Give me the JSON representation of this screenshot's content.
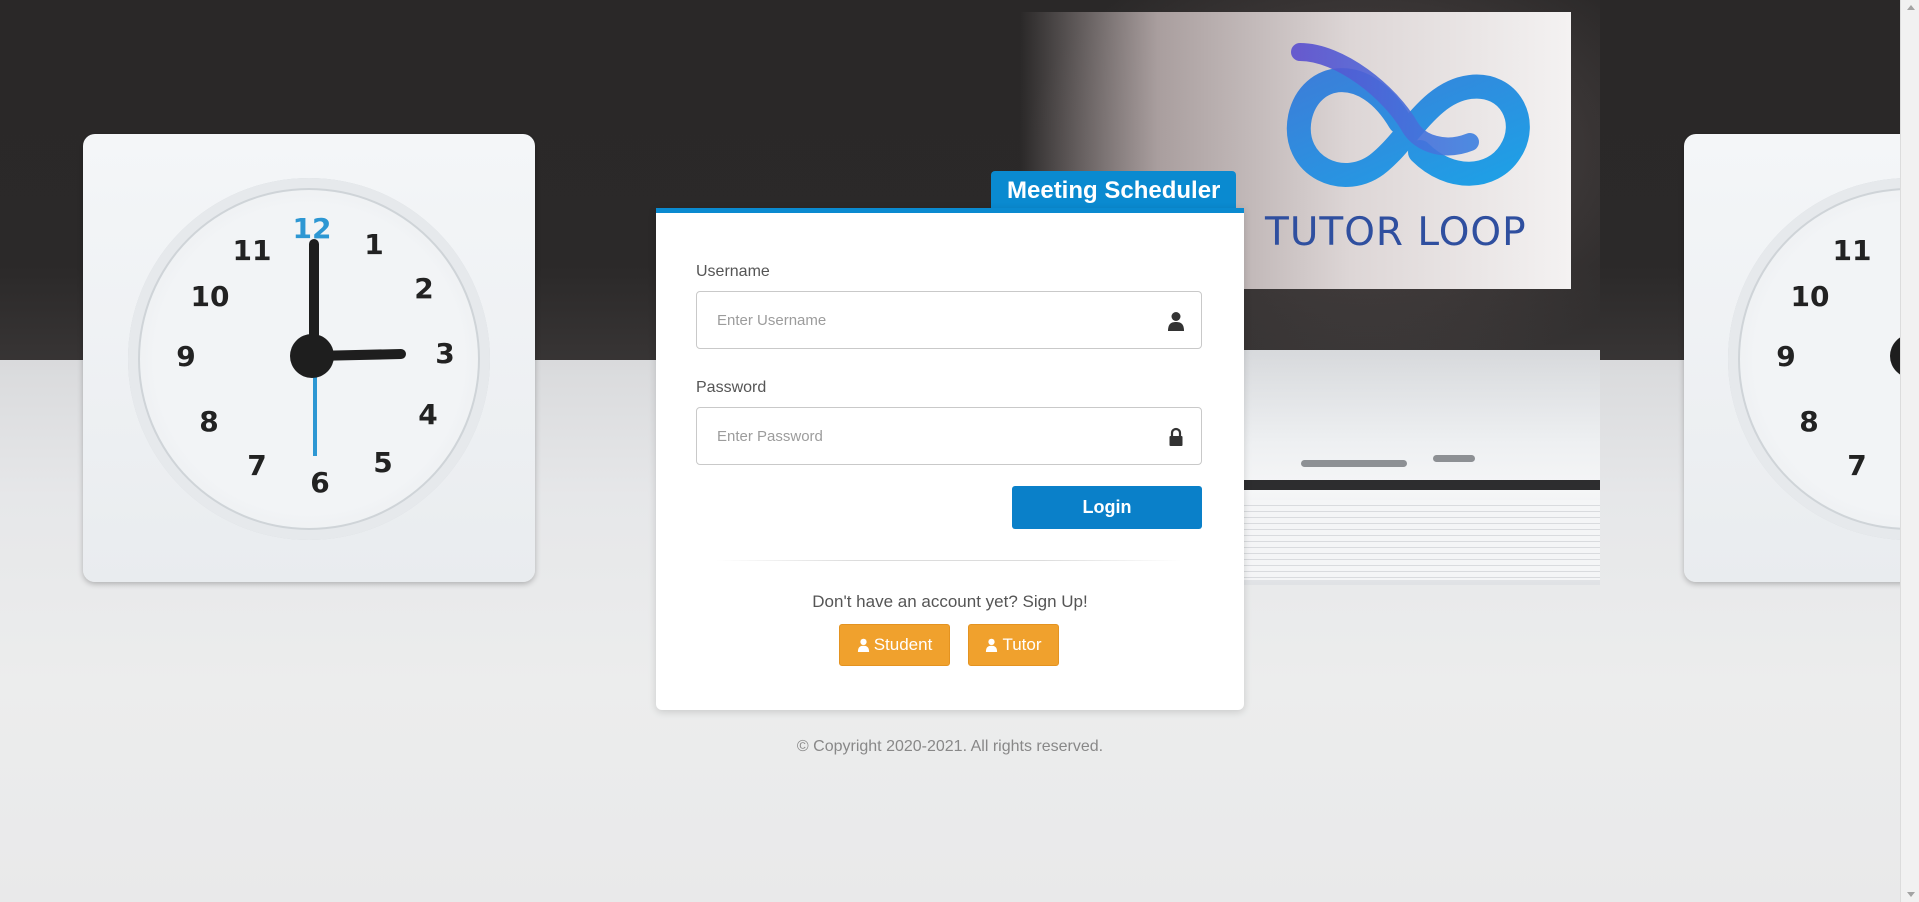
{
  "brand": {
    "logo_text": "TUTOR LOOP",
    "app_title": "Meeting Scheduler",
    "accent_color": "#0a8ad0"
  },
  "form": {
    "username_label": "Username",
    "username_placeholder": "Enter Username",
    "username_value": "",
    "username_icon": "user-icon",
    "password_label": "Password",
    "password_placeholder": "Enter Password",
    "password_value": "",
    "password_icon": "lock-icon",
    "login_label": "Login"
  },
  "signup": {
    "prompt": "Don't have an account yet? Sign Up!",
    "student_label": "Student",
    "tutor_label": "Tutor",
    "button_color": "#f0a12d",
    "button_icon": "user-icon"
  },
  "footer": {
    "copyright": "© Copyright 2020-2021. All rights reserved."
  },
  "clocks": {
    "left_numerals": [
      "12",
      "1",
      "2",
      "3",
      "4",
      "5",
      "6",
      "7",
      "8",
      "9",
      "10",
      "11"
    ],
    "right_numerals": [
      "11",
      "10",
      "9",
      "8",
      "7"
    ]
  }
}
